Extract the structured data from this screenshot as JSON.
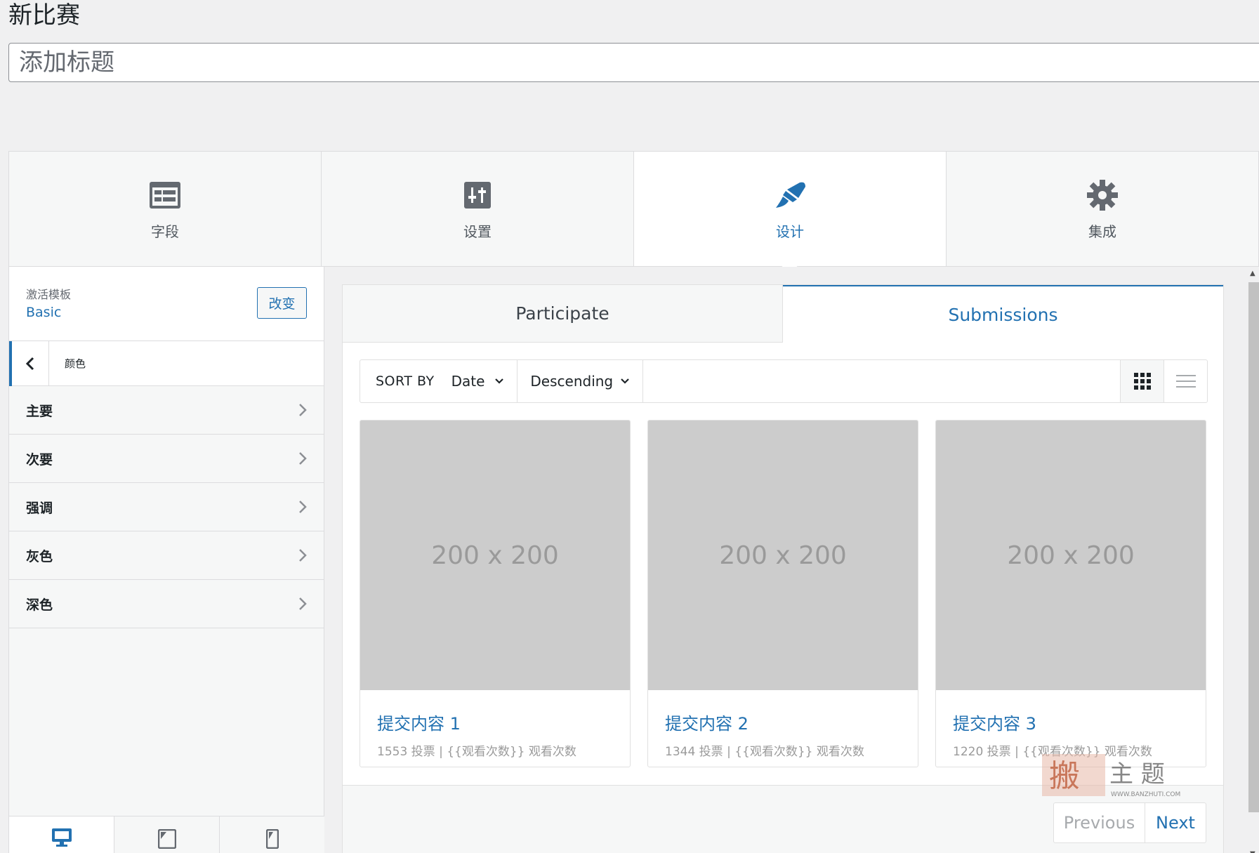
{
  "page": {
    "title": "新比赛"
  },
  "title_input": {
    "placeholder": "添加标题"
  },
  "main_tabs": [
    {
      "label": "字段",
      "icon": "fields-icon"
    },
    {
      "label": "设置",
      "icon": "settings-sliders-icon"
    },
    {
      "label": "设计",
      "icon": "paintbrush-icon",
      "active": true
    },
    {
      "label": "集成",
      "icon": "gear-icon"
    }
  ],
  "sidebar": {
    "template_label": "激活模板",
    "template_name": "Basic",
    "change_button": "改变",
    "section_title": "颜色",
    "colors": [
      "主要",
      "次要",
      "强调",
      "灰色",
      "深色"
    ]
  },
  "devices": [
    "desktop-icon",
    "tablet-icon",
    "mobile-icon"
  ],
  "preview": {
    "tabs": {
      "participate": "Participate",
      "submissions": "Submissions"
    },
    "sort_label": "SORT BY",
    "sort_field": "Date",
    "sort_order": "Descending",
    "cards": [
      {
        "image_text": "200 x 200",
        "title": "提交内容 1",
        "meta": "1553 投票 | {{观看次数}} 观看次数"
      },
      {
        "image_text": "200 x 200",
        "title": "提交内容 2",
        "meta": "1344 投票 | {{观看次数}} 观看次数"
      },
      {
        "image_text": "200 x 200",
        "title": "提交内容 3",
        "meta": "1220 投票 | {{观看次数}} 观看次数"
      }
    ],
    "pager": {
      "previous": "Previous",
      "next": "Next"
    }
  },
  "watermark": {
    "text": "搬主题",
    "url": "WWW.BANZHUTI.COM"
  },
  "colors": {
    "accent": "#2271b1",
    "border": "#dcdcde",
    "placeholder_gray": "#cccccc"
  }
}
